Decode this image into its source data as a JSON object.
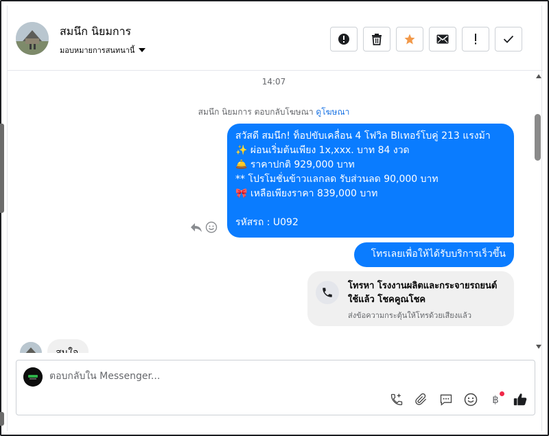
{
  "header": {
    "contact_name": "สมนึก นิยมการ",
    "assign_label": "มอบหมายการสนทนานี้"
  },
  "actions": [
    {
      "name": "spam-button",
      "icon": "alert-circle-icon"
    },
    {
      "name": "delete-button",
      "icon": "trash-icon"
    },
    {
      "name": "star-button",
      "icon": "star-icon",
      "color": "#f2994a"
    },
    {
      "name": "mark-unread-button",
      "icon": "envelope-icon"
    },
    {
      "name": "follow-up-button",
      "icon": "exclamation-icon"
    },
    {
      "name": "mark-done-button",
      "icon": "check-icon"
    }
  ],
  "thread": {
    "timestamp": "14:07",
    "system_text": "สมนึก นิยมการ ตอบกลับโฆษณา",
    "system_link": "ดูโฆษณา",
    "outgoing_ad_message": {
      "lines": [
        "สวัสดี สมนึก! ท็อปขับเคลื่อน 4 โฟวิล BIเทอร์โบคู่ 213 แรงม้า",
        "✨  ผ่อนเริ่มต้นเพียง 1x,xxx. บาท 84 งวด",
        "🛎️ ราคาปกติ  929,000 บาท",
        "** โปรโมชั่นข้าวแลกลด รับส่วนลด 90,000 บาท",
        "🎀  เหลือเพียงราคา 839,000 บาท",
        "",
        " รหัสรถ : U092"
      ]
    },
    "outgoing_button_text": "โทรเลยเพื่อให้ได้รับบริการเร็วขึ้น",
    "call_card": {
      "title": "โทรหา โรงงานผลิตและกระจายรถยนต์ใช้แล้ว โชคคูณโชค",
      "subtitle": "ส่งข้อความกระตุ้นให้โทรด้วยเสียงแล้ว"
    },
    "incoming_message": "สนใจ"
  },
  "composer": {
    "placeholder": "ตอบกลับใน Messenger...",
    "value": ""
  },
  "colors": {
    "brand_blue": "#0a7cff",
    "star": "#f2994a",
    "link": "#1b74e4",
    "notification_dot": "#f02849"
  }
}
